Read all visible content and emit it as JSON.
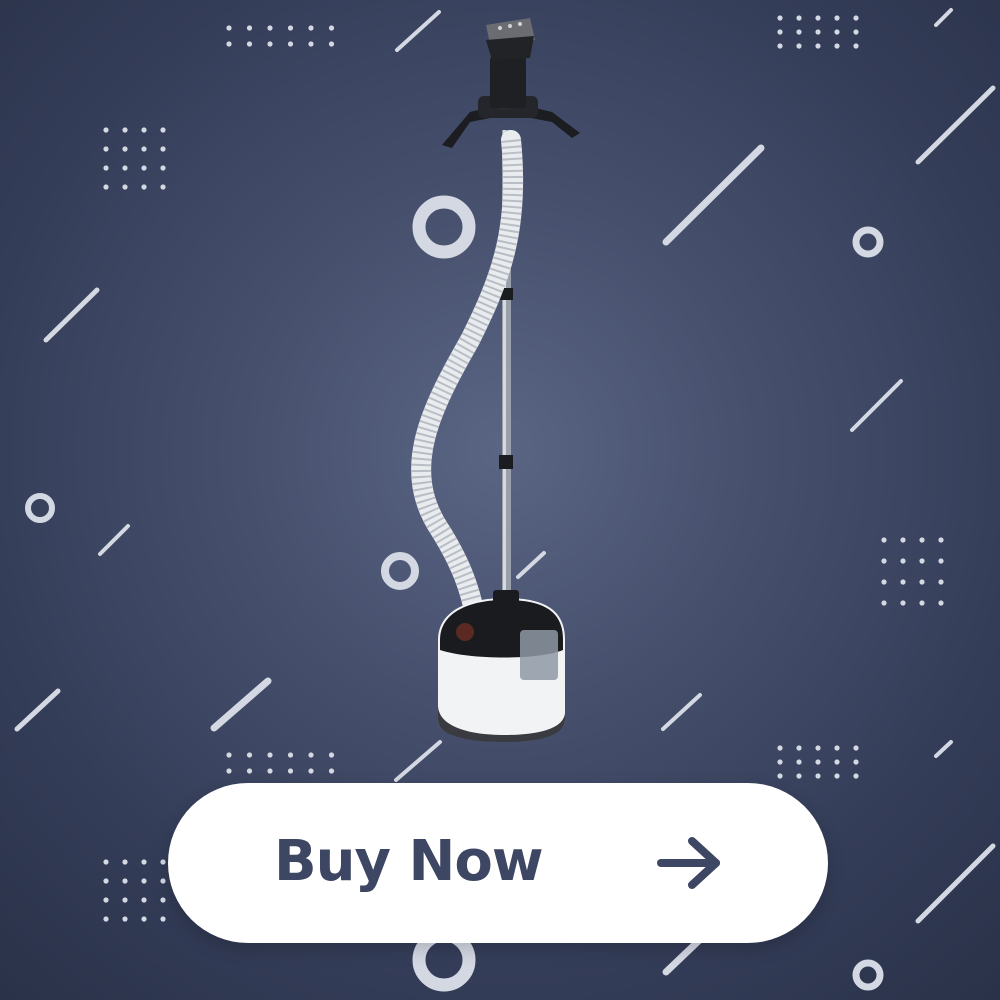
{
  "cta": {
    "label": "Buy Now",
    "icon": "arrow-right-icon"
  },
  "product": {
    "type": "garment-steamer-image"
  },
  "colors": {
    "background": "#46506d",
    "background_edge": "#2a3249",
    "decoration": "#d4d8e3",
    "button_fill": "#ffffff",
    "button_text": "#3d4663"
  }
}
